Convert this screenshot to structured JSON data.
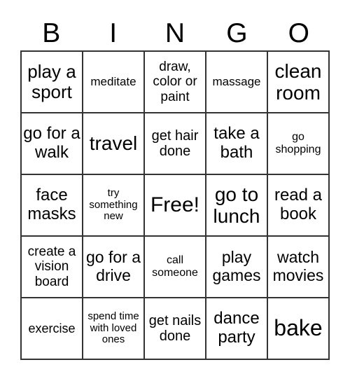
{
  "header": [
    "B",
    "I",
    "N",
    "G",
    "O"
  ],
  "cells": [
    "play a sport",
    "meditate",
    "draw, color or paint",
    "massage",
    "clean room",
    "go for a walk",
    "travel",
    "get hair done",
    "take a bath",
    "go shopping",
    "face masks",
    "try something new",
    "Free!",
    "go to lunch",
    "read a book",
    "create a vision board",
    "go for a drive",
    "call someone",
    "play games",
    "watch movies",
    "exercise",
    "spend time with loved ones",
    "get nails done",
    "dance party",
    "bake"
  ]
}
